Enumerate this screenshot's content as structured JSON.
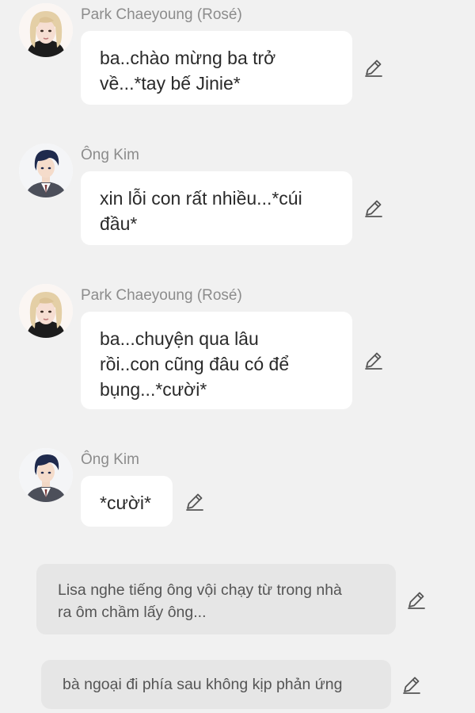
{
  "messages": [
    {
      "sender": "Park Chaeyoung (Rosé)",
      "avatar": "rose-avatar",
      "lines": [
        "ba..chào mừng ba trở",
        "về...*tay bế Jinie*"
      ]
    },
    {
      "sender": "Ông Kim",
      "avatar": "ong-kim-avatar",
      "lines": [
        "xin lỗi con rất nhiều...*cúi",
        "đầu*"
      ]
    },
    {
      "sender": "Park Chaeyoung (Rosé)",
      "avatar": "rose-avatar",
      "lines": [
        "ba...chuyện qua lâu",
        "rồi..con cũng đâu có để",
        "bụng...*cười*"
      ]
    },
    {
      "sender": "Ông Kim",
      "avatar": "ong-kim-avatar",
      "lines": [
        "*cười*"
      ]
    }
  ],
  "narrations": [
    {
      "lines": [
        "Lisa nghe tiếng ông vội chạy từ trong nhà",
        "ra ôm chầm lấy ông..."
      ]
    },
    {
      "lines": [
        "bà ngoại đi phía sau không kịp phản ứng"
      ]
    }
  ],
  "icons": {
    "edit": "pencil-icon"
  },
  "colors": {
    "background": "#f1f1f1",
    "bubble": "#ffffff",
    "narration": "#e6e6e6",
    "sender_text": "#8c8c8c",
    "message_text": "#2a2a2a"
  }
}
